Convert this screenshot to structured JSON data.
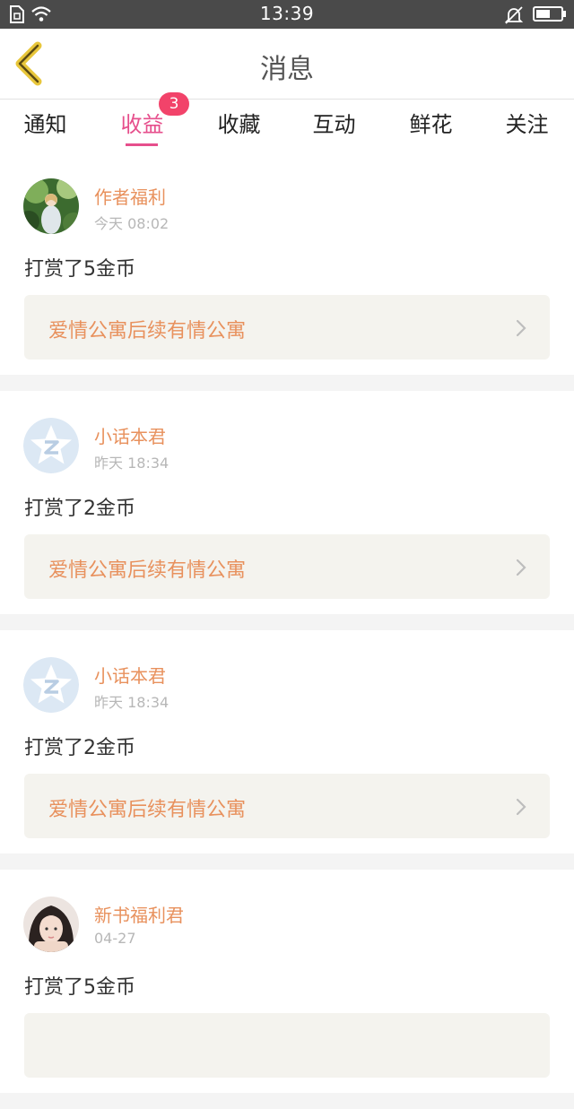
{
  "status_bar": {
    "time": "13:39",
    "icons": [
      "sim-icon",
      "wifi-icon",
      "mute-icon",
      "battery-icon"
    ]
  },
  "header": {
    "title": "消息",
    "back_icon": "back-chevron-icon"
  },
  "tabs": [
    {
      "label": "通知",
      "active": false
    },
    {
      "label": "收益",
      "active": true,
      "badge": "3"
    },
    {
      "label": "收藏",
      "active": false
    },
    {
      "label": "互动",
      "active": false
    },
    {
      "label": "鲜花",
      "active": false
    },
    {
      "label": "关注",
      "active": false
    }
  ],
  "colors": {
    "accent": "#e64f8c",
    "badge": "#f2436a",
    "orange_text": "#e8915d",
    "status_bar": "#4a4a4a"
  },
  "messages": [
    {
      "sender": "作者福利",
      "time": "今天 08:02",
      "text": "打赏了5金币",
      "book": "爱情公寓后续有情公寓",
      "avatar": "forest-girl-avatar"
    },
    {
      "sender": "小话本君",
      "time": "昨天 18:34",
      "text": "打赏了2金币",
      "book": "爱情公寓后续有情公寓",
      "avatar": "qq-star-avatar"
    },
    {
      "sender": "小话本君",
      "time": "昨天 18:34",
      "text": "打赏了2金币",
      "book": "爱情公寓后续有情公寓",
      "avatar": "qq-star-avatar"
    },
    {
      "sender": "新书福利君",
      "time": "04-27",
      "text": "打赏了5金币",
      "book": "",
      "avatar": "girl-portrait-avatar"
    }
  ]
}
